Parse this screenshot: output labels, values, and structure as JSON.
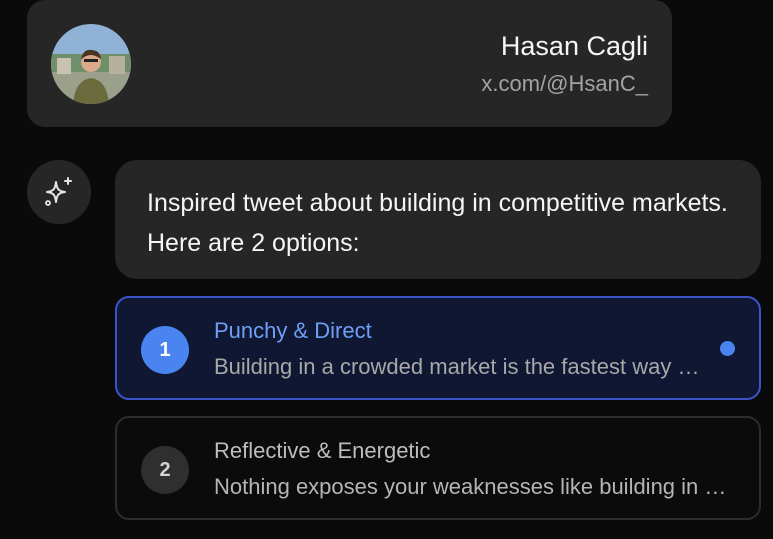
{
  "profile": {
    "name": "Hasan Cagli",
    "handle": "x.com/@HsanC_"
  },
  "assistant": {
    "icon": "sparkles-icon",
    "message": "Inspired tweet about building in competitive markets. Here are 2 options:"
  },
  "options": [
    {
      "number": "1",
      "title": "Punchy & Direct",
      "preview": "Building in a crowded market is the fastest way to learn.",
      "selected": true
    },
    {
      "number": "2",
      "title": "Reflective & Energetic",
      "preview": "Nothing exposes your weaknesses like building in a competitive market.",
      "selected": false
    }
  ],
  "colors": {
    "accent": "#4a84f0",
    "card": "#262626",
    "background": "#0a0a0a"
  }
}
